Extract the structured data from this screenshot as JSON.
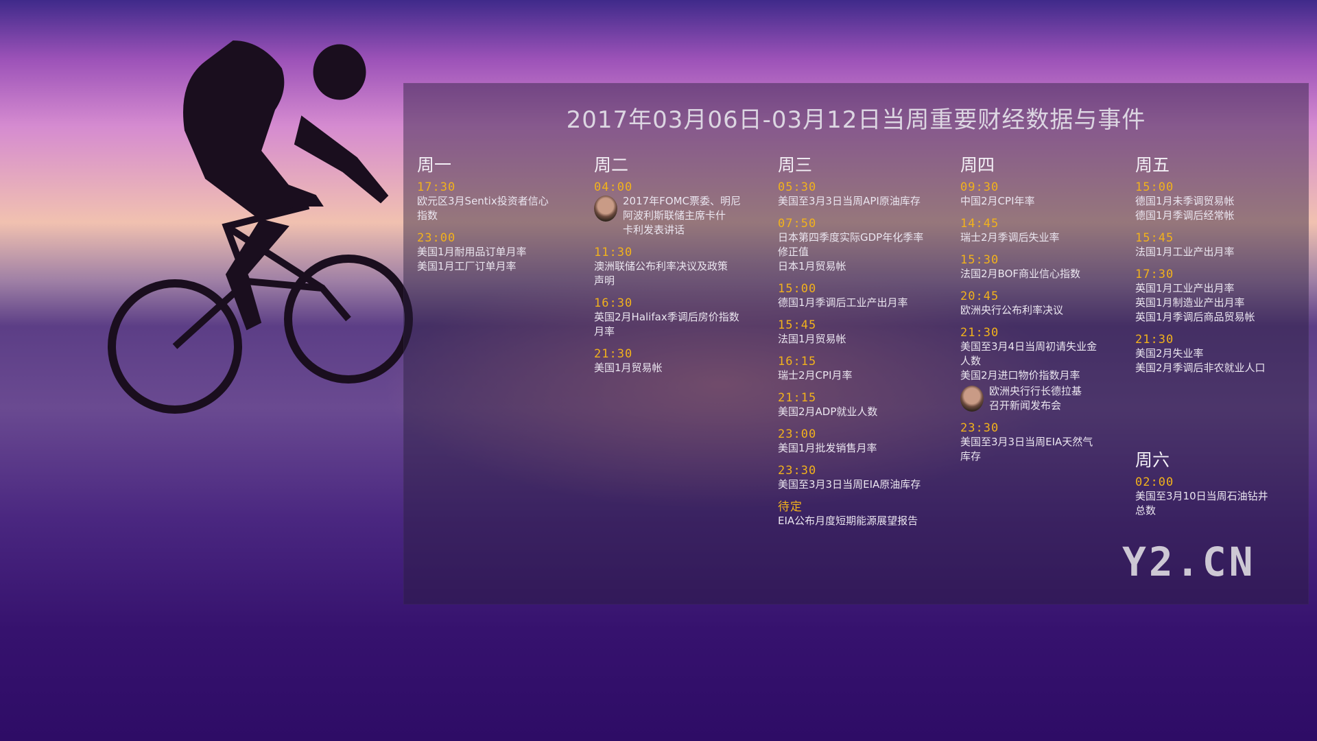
{
  "title": "2017年03月06日-03月12日当周重要财经数据与事件",
  "logo": "Y2.CN",
  "days": [
    {
      "name": "周一",
      "events": [
        {
          "time": "17:30",
          "desc": [
            "欧元区3月Sentix投资者信心",
            "指数"
          ]
        },
        {
          "time": "23:00",
          "desc": [
            "美国1月耐用品订单月率",
            "美国1月工厂订单月率"
          ]
        }
      ]
    },
    {
      "name": "周二",
      "events": [
        {
          "time": "04:00",
          "desc": [
            "2017年FOMC票委、明尼",
            "阿波利斯联储主席卡什",
            "卡利发表讲话"
          ],
          "avatar": true
        },
        {
          "time": "11:30",
          "desc": [
            "澳洲联储公布利率决议及政策",
            "声明"
          ]
        },
        {
          "time": "16:30",
          "desc": [
            "英国2月Halifax季调后房价指数",
            "月率"
          ]
        },
        {
          "time": "21:30",
          "desc": [
            "美国1月贸易帐"
          ]
        }
      ]
    },
    {
      "name": "周三",
      "events": [
        {
          "time": "05:30",
          "desc": [
            "美国至3月3日当周API原油库存"
          ]
        },
        {
          "time": "07:50",
          "desc": [
            "日本第四季度实际GDP年化季率",
            "修正值",
            "日本1月贸易帐"
          ]
        },
        {
          "time": "15:00",
          "desc": [
            "德国1月季调后工业产出月率"
          ]
        },
        {
          "time": "15:45",
          "desc": [
            "法国1月贸易帐"
          ]
        },
        {
          "time": "16:15",
          "desc": [
            "瑞士2月CPI月率"
          ]
        },
        {
          "time": "21:15",
          "desc": [
            "美国2月ADP就业人数"
          ]
        },
        {
          "time": "23:00",
          "desc": [
            "美国1月批发销售月率"
          ]
        },
        {
          "time": "23:30",
          "desc": [
            "美国至3月3日当周EIA原油库存"
          ]
        },
        {
          "time": "待定",
          "desc": [
            "EIA公布月度短期能源展望报告"
          ]
        }
      ]
    },
    {
      "name": "周四",
      "events": [
        {
          "time": "09:30",
          "desc": [
            "中国2月CPI年率"
          ]
        },
        {
          "time": "14:45",
          "desc": [
            "瑞士2月季调后失业率"
          ]
        },
        {
          "time": "15:30",
          "desc": [
            "法国2月BOF商业信心指数"
          ]
        },
        {
          "time": "20:45",
          "desc": [
            "欧洲央行公布利率决议"
          ]
        },
        {
          "time": "21:30",
          "desc": [
            "美国至3月4日当周初请失业金",
            "人数",
            "美国2月进口物价指数月率"
          ],
          "extra": [
            "欧洲央行行长德拉基",
            "召开新闻发布会"
          ]
        },
        {
          "time": "23:30",
          "desc": [
            "美国至3月3日当周EIA天然气",
            "库存"
          ]
        }
      ]
    },
    {
      "name": "周五",
      "events": [
        {
          "time": "15:00",
          "desc": [
            "德国1月未季调贸易帐",
            "德国1月季调后经常帐"
          ]
        },
        {
          "time": "15:45",
          "desc": [
            "法国1月工业产出月率"
          ]
        },
        {
          "time": "17:30",
          "desc": [
            "英国1月工业产出月率",
            "英国1月制造业产出月率",
            "英国1月季调后商品贸易帐"
          ]
        },
        {
          "time": "21:30",
          "desc": [
            "美国2月失业率",
            "美国2月季调后非农就业人口"
          ]
        }
      ]
    },
    {
      "name": "周六",
      "events": [
        {
          "time": "02:00",
          "desc": [
            "美国至3月10日当周石油钻井",
            "总数"
          ]
        }
      ]
    }
  ]
}
